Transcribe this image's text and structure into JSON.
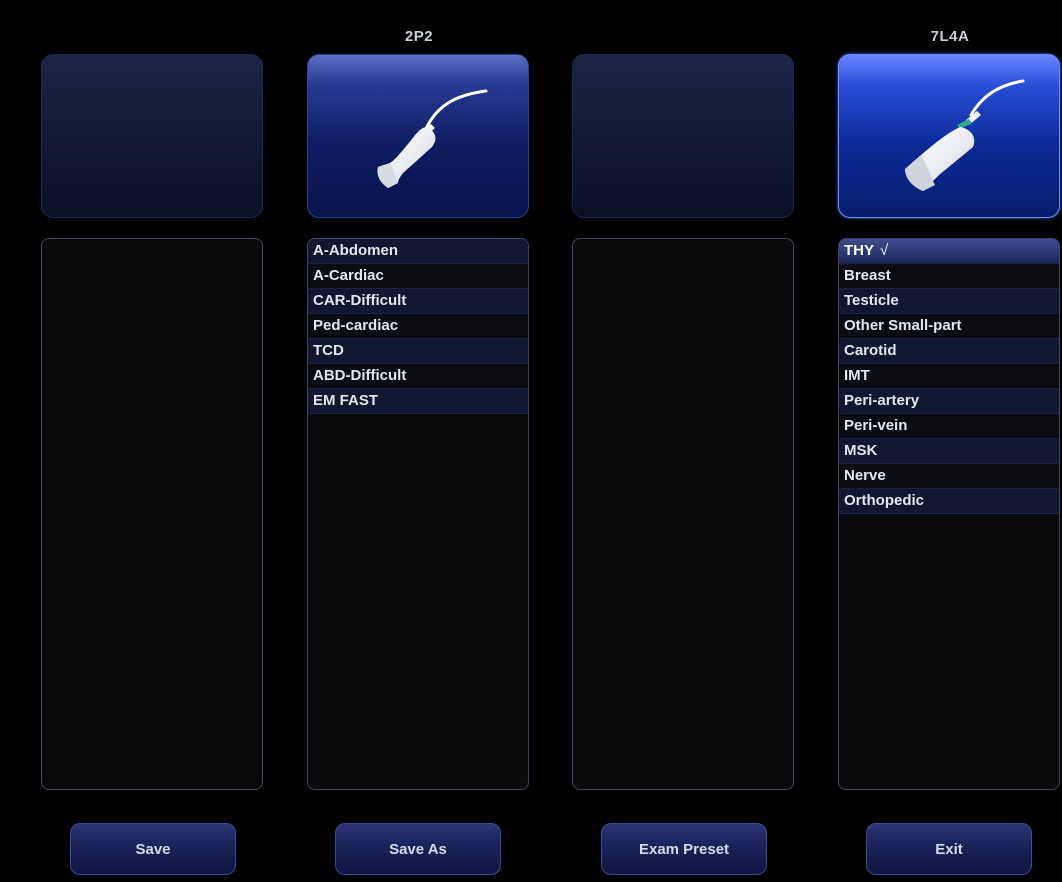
{
  "probes": [
    {
      "name": "",
      "state": "empty",
      "exams": []
    },
    {
      "name": "2P2",
      "state": "connected",
      "exams": [
        "A-Abdomen",
        "A-Cardiac",
        "CAR-Difficult",
        "Ped-cardiac",
        "TCD",
        "ABD-Difficult",
        "EM FAST"
      ]
    },
    {
      "name": "",
      "state": "empty",
      "exams": []
    },
    {
      "name": "7L4A",
      "state": "selected",
      "exams": [
        "THY",
        "Breast",
        "Testicle",
        "Other Small-part",
        "Carotid",
        "IMT",
        "Peri-artery",
        "Peri-vein",
        "MSK",
        "Nerve",
        "Orthopedic"
      ],
      "active_exam": "THY",
      "check_mark": "√"
    }
  ],
  "buttons": {
    "save": "Save",
    "save_as": "Save As",
    "exam_preset": "Exam Preset",
    "exit": "Exit"
  },
  "icons": {
    "probe_2p2": "phased-array-probe-icon",
    "probe_7l4a": "linear-probe-icon"
  },
  "colors": {
    "background": "#000000",
    "tile_selected": "#0c2a96",
    "tile_connected": "#0d1d63",
    "list_row_dark": "#0b0c12",
    "list_row_light": "#121731",
    "active_row": "#2a3772",
    "button": "#1a2258",
    "text": "#e3e6f0"
  }
}
